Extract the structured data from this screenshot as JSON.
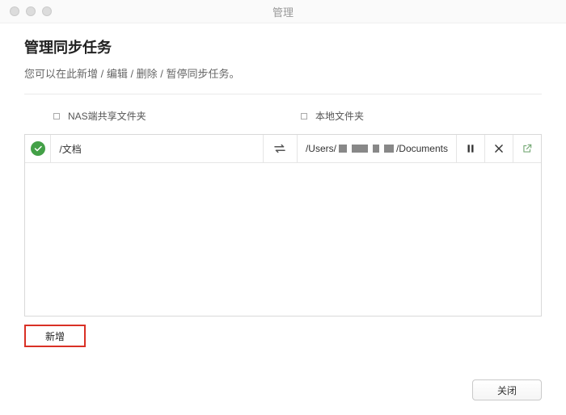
{
  "window": {
    "title": "管理"
  },
  "page": {
    "heading": "管理同步任务",
    "subtitle": "您可以在此新增 / 编辑 / 删除 / 暂停同步任务。"
  },
  "columns": {
    "nas": "NAS端共享文件夹",
    "local": "本地文件夹"
  },
  "tasks": [
    {
      "status": "ok",
      "nas_path": "/文档",
      "direction": "bidirectional",
      "local_prefix": "/Users/",
      "local_suffix": "/Documents"
    }
  ],
  "buttons": {
    "add": "新增",
    "close": "关闭"
  },
  "icons": {
    "status_ok": "check-circle",
    "direction": "swap-arrows",
    "pause": "pause",
    "remove": "x",
    "open": "external-link"
  }
}
